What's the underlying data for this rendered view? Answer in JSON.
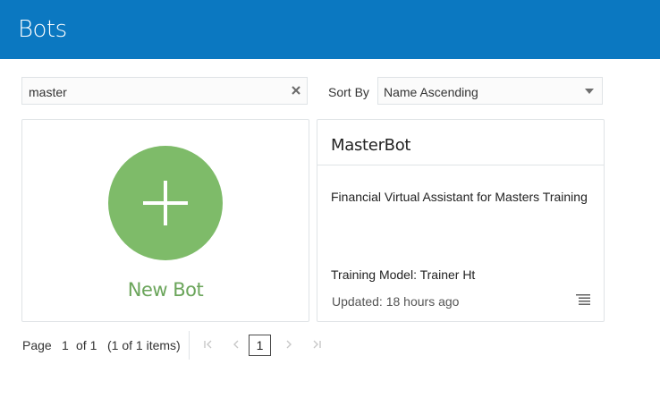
{
  "header": {
    "title": "Bots"
  },
  "search": {
    "value": "master",
    "clear_icon": "close-icon"
  },
  "sort": {
    "label": "Sort By",
    "selected": "Name Ascending"
  },
  "new_bot": {
    "label": "New Bot",
    "icon": "plus-icon",
    "color": "#7ebb69"
  },
  "bots": [
    {
      "name": "MasterBot",
      "description": "Financial Virtual Assistant for Masters Training",
      "model": "Training Model: Trainer Ht",
      "updated": "Updated: 18 hours ago",
      "menu_icon": "list-menu-icon"
    }
  ],
  "pagination": {
    "page_label": "Page",
    "current_page": "1",
    "of_pages": "of 1",
    "items_summary": "(1 of 1 items)",
    "page_button": "1"
  },
  "colors": {
    "header": "#0b78c1",
    "accent_green": "#7ebb69"
  }
}
